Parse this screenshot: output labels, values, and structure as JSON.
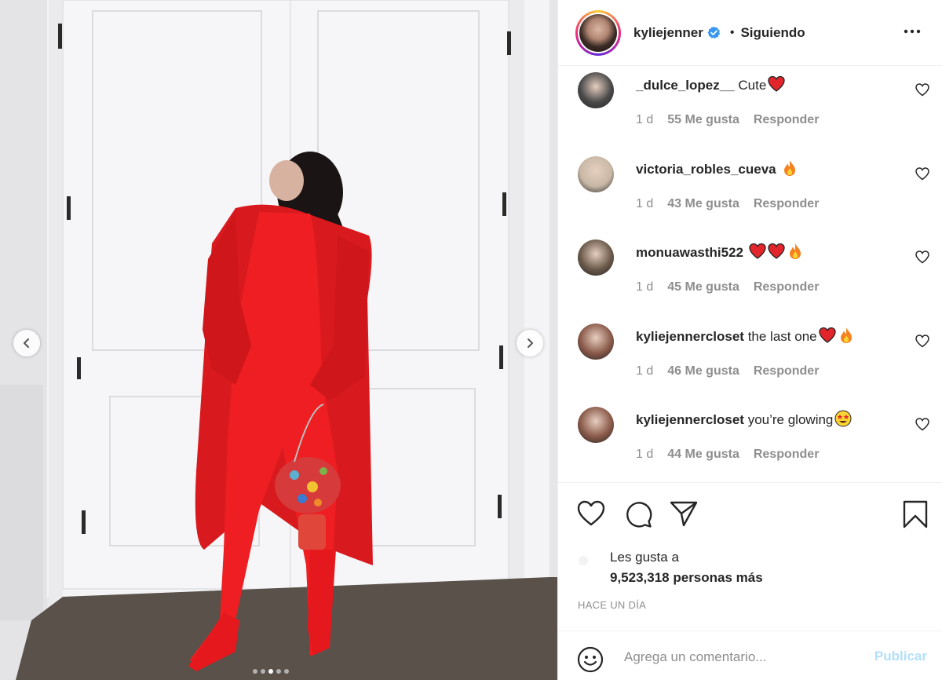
{
  "post": {
    "image_alt_subject": "woman in red outfit",
    "carousel": {
      "total": 5,
      "active": 3
    }
  },
  "header": {
    "username": "kyliejenner",
    "separator": "•",
    "follow_status": "Siguiendo",
    "verified": true
  },
  "comments": [
    {
      "user": "_dulce_lopez__",
      "text": "Cute",
      "emoji": [
        "heart"
      ],
      "time": "1 d",
      "likes": "55 Me gusta",
      "reply": "Responder",
      "avatar_color": "#4a4a4a"
    },
    {
      "user": "victoria_robles_cueva",
      "text": "",
      "emoji": [
        "fire"
      ],
      "time": "1 d",
      "likes": "43 Me gusta",
      "reply": "Responder",
      "avatar_color": "#c9b8a6"
    },
    {
      "user": "monuawasthi522",
      "text": "",
      "emoji": [
        "heart",
        "heart",
        "fire"
      ],
      "time": "1 d",
      "likes": "45 Me gusta",
      "reply": "Responder",
      "avatar_color": "#6b5a4a"
    },
    {
      "user": "kyliejennercloset",
      "text": "the last one",
      "emoji": [
        "heart",
        "fire"
      ],
      "time": "1 d",
      "likes": "46 Me gusta",
      "reply": "Responder",
      "avatar_color": "#8a5a4a"
    },
    {
      "user": "kyliejennercloset",
      "text": "you’re glowing",
      "emoji": [
        "star-eyes"
      ],
      "time": "1 d",
      "likes": "44 Me gusta",
      "reply": "Responder",
      "avatar_color": "#8a5a4a"
    }
  ],
  "likes": {
    "line1": "Les gusta a",
    "line2": "9,523,318 personas más"
  },
  "timestamp": "HACE UN DÍA",
  "add_comment": {
    "placeholder": "Agrega un comentario...",
    "publish_label": "Publicar"
  },
  "colors": {
    "outfit_red": "#e0191e",
    "text": "#262626",
    "secondary": "#8e8e8e",
    "verified_blue": "#3897f0",
    "publish_disabled": "#b2dffc"
  },
  "icons": {
    "like": "heart-icon",
    "comment": "comment-icon",
    "share": "paper-plane-icon",
    "save": "bookmark-icon",
    "more": "more-options-icon",
    "emoji": "emoji-icon"
  }
}
